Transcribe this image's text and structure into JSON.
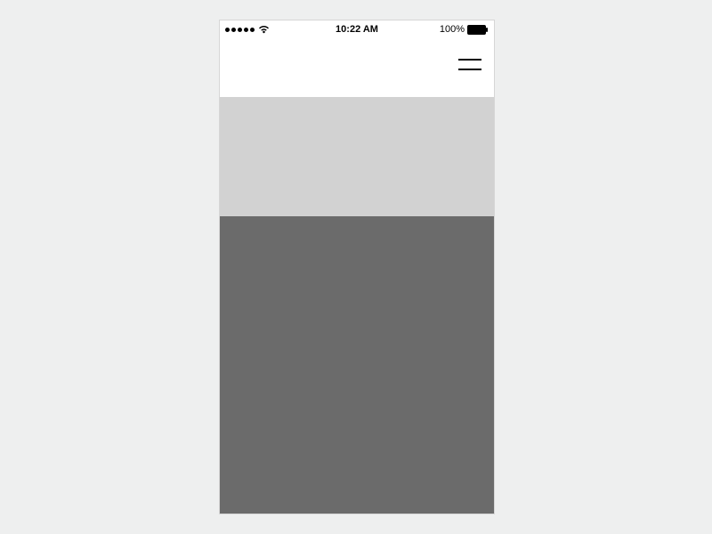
{
  "status_bar": {
    "time": "10:22 AM",
    "battery_text": "100%"
  }
}
